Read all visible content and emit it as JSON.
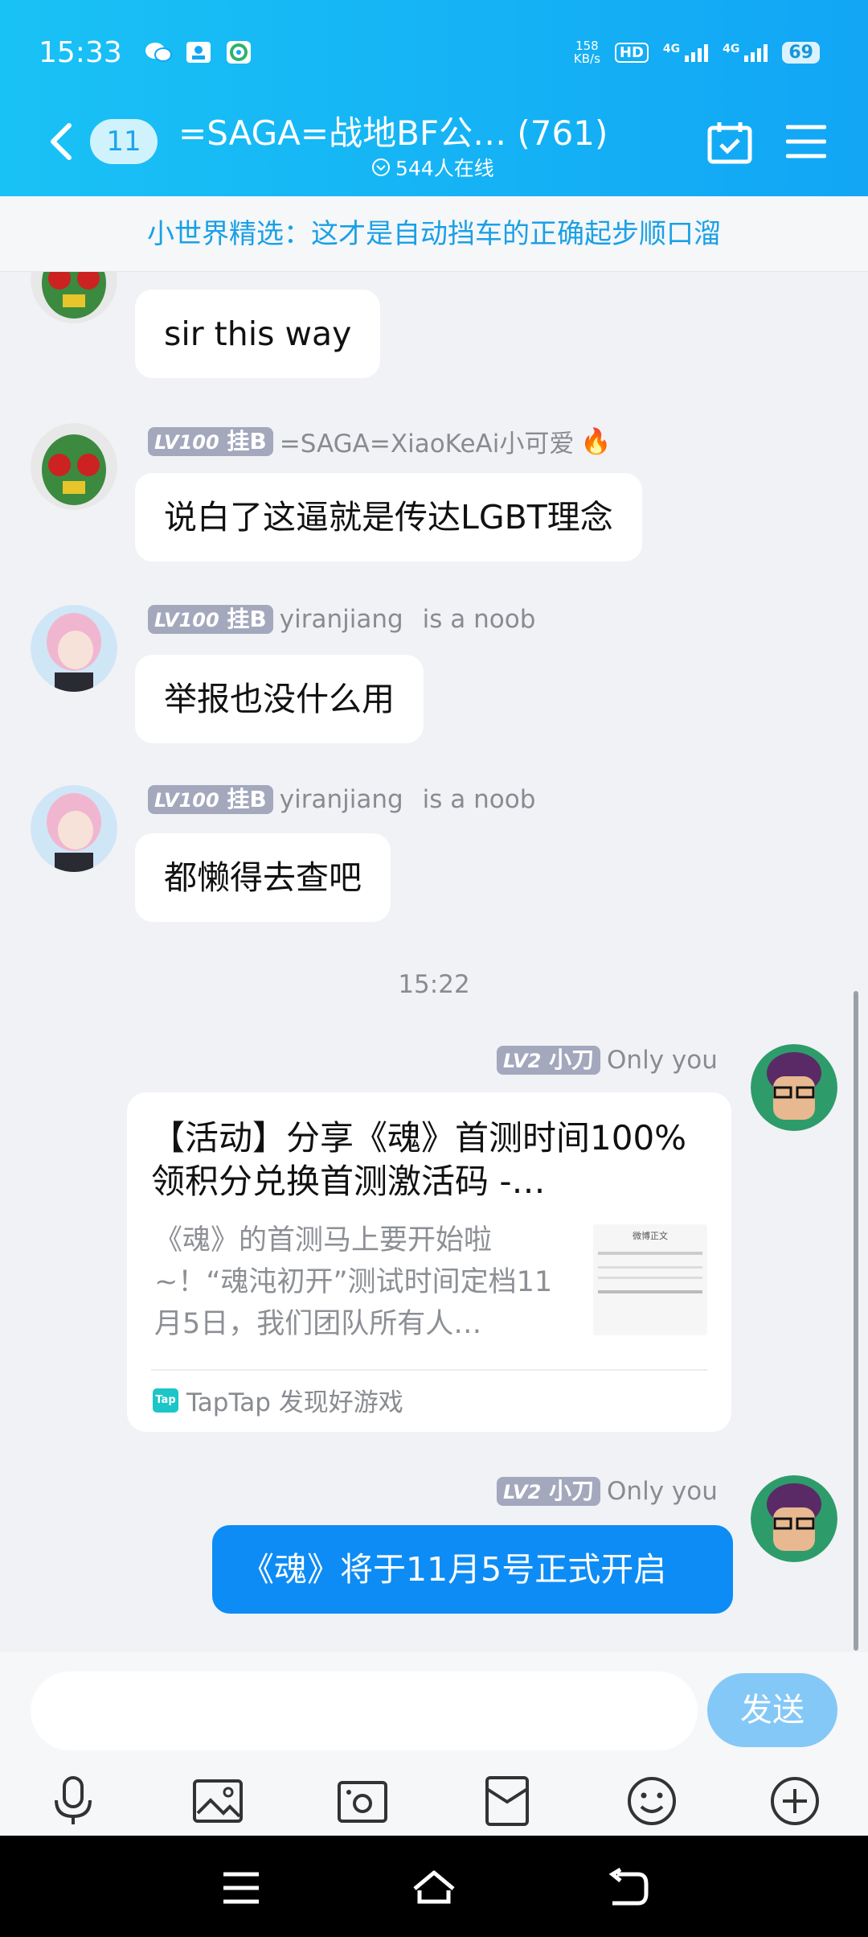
{
  "status_bar": {
    "time": "15:33",
    "net_speed_value": "158",
    "net_speed_unit": "KB/s",
    "hd_label": "HD",
    "signal1_label": "4G",
    "signal2_label": "4G",
    "battery": "69"
  },
  "header": {
    "unread_count": "11",
    "title": "=SAGA=战地BF公… (761)",
    "online": "544人在线"
  },
  "banner": "小世界精选：这才是自动挡车的正确起步顺口溜",
  "messages": [
    {
      "text": "sir this way"
    },
    {
      "level": "LV100",
      "tag": "挂B",
      "name": "=SAGA=XiaoKeAi小可爱",
      "emoji": "🔥",
      "text": "说白了这逼就是传达LGBT理念"
    },
    {
      "level": "LV100",
      "tag": "挂B",
      "name": "yiranjiang",
      "suffix": "is a noob",
      "text": "举报也没什么用"
    },
    {
      "level": "LV100",
      "tag": "挂B",
      "name": "yiranjiang",
      "suffix": "is a noob",
      "text": "都懒得去查吧"
    }
  ],
  "timestamp": "15:22",
  "my_messages": [
    {
      "level": "LV2",
      "tag": "小刀",
      "name": "Only you",
      "card": {
        "title": "【活动】分享《魂》首测时间100%领积分兑换首测激活码 -…",
        "desc": "《魂》的首测马上要开始啦~！“魂沌初开”测试时间定档11月5日，我们团队所有人…",
        "source": "TapTap 发现好游戏",
        "thumb_label": "微博正文"
      }
    },
    {
      "level": "LV2",
      "tag": "小刀",
      "name": "Only you",
      "text": "《魂》将于11月5号正式开启"
    }
  ],
  "input": {
    "placeholder": "",
    "send_label": "发送"
  },
  "colors": {
    "header": "#12a6f5",
    "accent": "#0d8cf5",
    "send": "#84c8f7"
  }
}
